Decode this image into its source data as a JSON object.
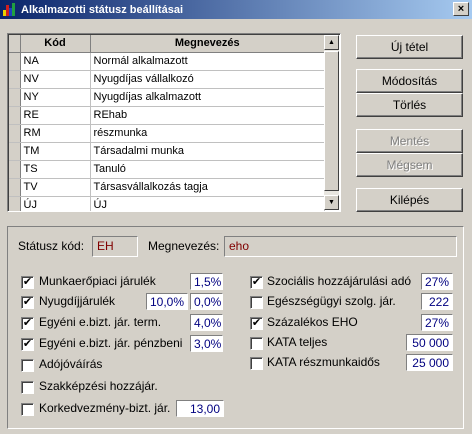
{
  "window": {
    "title": "Alkalmazotti státusz beállításai",
    "close": "×"
  },
  "grid": {
    "headers": {
      "code": "Kód",
      "name": "Megnevezés"
    },
    "rows": [
      {
        "code": "NA",
        "name": "Normál alkalmazott"
      },
      {
        "code": "NV",
        "name": "Nyugdíjas vállalkozó"
      },
      {
        "code": "NY",
        "name": "Nyugdíjas alkalmazott"
      },
      {
        "code": "RE",
        "name": "REhab"
      },
      {
        "code": "RM",
        "name": "részmunka"
      },
      {
        "code": "TM",
        "name": "Társadalmi munka"
      },
      {
        "code": "TS",
        "name": "Tanuló"
      },
      {
        "code": "TV",
        "name": "Társasvállalkozás tagja"
      },
      {
        "code": "ÚJ",
        "name": "ÚJ"
      }
    ]
  },
  "buttons": {
    "new": "Új tétel",
    "modify": "Módosítás",
    "delete": "Törlés",
    "save": "Mentés",
    "cancel": "Mégsem",
    "exit": "Kilépés"
  },
  "form": {
    "status_code_label": "Státusz kód:",
    "status_code_value": "EH",
    "name_label": "Megnevezés:",
    "name_value": "eho",
    "left": [
      {
        "label": "Munkaerőpiaci járulék",
        "checked": true,
        "value": "1,5%"
      },
      {
        "label": "Nyugdíjjárulék",
        "checked": true,
        "value1": "10,0%",
        "value": "0,0%"
      },
      {
        "label": "Egyéni e.bizt. jár. term.",
        "checked": true,
        "value": "4,0%"
      },
      {
        "label": "Egyéni e.bizt. jár. pénzbeni",
        "checked": true,
        "value": "3,0%"
      },
      {
        "label": "Adójóváírás",
        "checked": false
      },
      {
        "label": "Szakképzési hozzájár.",
        "checked": false
      },
      {
        "label": "Korkedvezmény-bizt. jár.",
        "checked": false,
        "value": "13,00"
      }
    ],
    "right": [
      {
        "label": "Szociális hozzájárulási adó",
        "checked": true,
        "value": "27%"
      },
      {
        "label": "Egészségügyi szolg. jár.",
        "checked": false,
        "value": "222"
      },
      {
        "label": "Százalékos EHO",
        "checked": true,
        "value": "27%"
      },
      {
        "label": "KATA teljes",
        "checked": false,
        "value": "50 000"
      },
      {
        "label": "KATA részmunkaidős",
        "checked": false,
        "value": "25 000"
      }
    ]
  },
  "icons": {
    "app": "app-icon",
    "checkmark": "✔",
    "scroll_up": "▲",
    "scroll_down": "▼"
  }
}
